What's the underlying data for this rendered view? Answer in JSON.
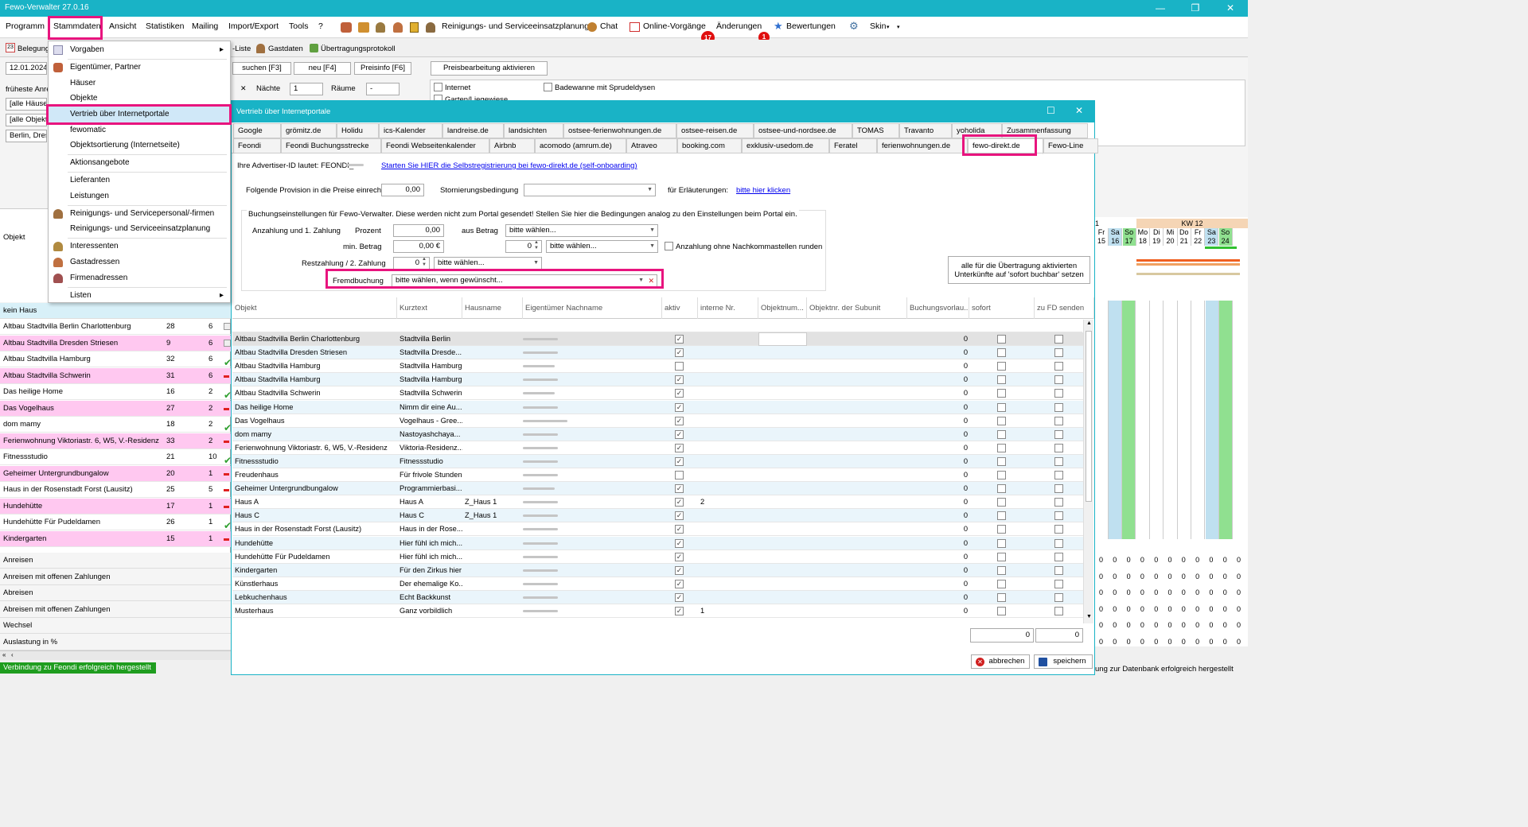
{
  "window": {
    "title": "Fewo-Verwalter 27.0.16"
  },
  "menubar": {
    "items": [
      "Programm",
      "Stammdaten",
      "Ansicht",
      "Statistiken",
      "Mailing",
      "Import/Export",
      "Tools",
      "?"
    ],
    "reinigung": "Reinigungs- und Serviceeinsatzplanung",
    "chat": "Chat",
    "online": "Online-Vorgänge",
    "online_badge": "17",
    "aenderungen": "Änderungen",
    "aenderungen_badge": "1",
    "bewertungen": "Bewertungen",
    "skin": "Skin"
  },
  "toolbar": {
    "belegung": "Belegung",
    "liste": "-Liste",
    "gastdaten": "Gastdaten",
    "protokoll": "Übertragungsprotokoll",
    "suchen": "suchen [F3]",
    "neu": "neu [F4]",
    "preisinfo": "Preisinfo [F6]",
    "preisbearbeitung": "Preisbearbeitung aktivieren",
    "naechte": "Nächte",
    "naechte_value": "1",
    "raeume": "Räume",
    "raeume_value": "-",
    "internet": "Internet",
    "badewanne": "Badewanne mit Sprudeldysen",
    "garten": "Garten/Liegewiese"
  },
  "leftpanel": {
    "date": "12.01.2024",
    "frueheste": "früheste Anre",
    "haeuser": "[alle Häuser]",
    "objekte": "[alle Objekte",
    "stadt": "Berlin, Dresde",
    "objekt_header": "Objekt"
  },
  "dropdown": {
    "items": [
      "Vorgaben",
      "Eigentümer, Partner",
      "Häuser",
      "Objekte",
      "Vertrieb über Internetportale",
      "fewomatic",
      "Objektsortierung (Internetseite)",
      "Aktionsangebote",
      "Lieferanten",
      "Leistungen",
      "Reinigungs- und Servicepersonal/-firmen",
      "Reinigungs- und Serviceeinsatzplanung",
      "Interessenten",
      "Gastadressen",
      "Firmenadressen",
      "Listen"
    ]
  },
  "houses": {
    "kein_haus": "kein Haus",
    "rows": [
      {
        "name": "Altbau Stadtvilla Berlin Charlottenburg",
        "a": "28",
        "b": "6",
        "pink": false,
        "mark": "grid"
      },
      {
        "name": "Altbau Stadtvilla Dresden Striesen",
        "a": "9",
        "b": "6",
        "pink": true,
        "mark": "grid"
      },
      {
        "name": "Altbau Stadtvilla Hamburg",
        "a": "32",
        "b": "6",
        "pink": false,
        "mark": "check"
      },
      {
        "name": "Altbau Stadtvilla Schwerin",
        "a": "31",
        "b": "6",
        "pink": true,
        "mark": "red"
      },
      {
        "name": "Das heilige Home",
        "a": "16",
        "b": "2",
        "pink": false,
        "mark": "check"
      },
      {
        "name": "Das Vogelhaus",
        "a": "27",
        "b": "2",
        "pink": true,
        "mark": "red"
      },
      {
        "name": "dom mamy",
        "a": "18",
        "b": "2",
        "pink": false,
        "mark": "check"
      },
      {
        "name": "Ferienwohnung Viktoriastr. 6, W5, V.-Residenz",
        "a": "33",
        "b": "2",
        "pink": true,
        "mark": "red"
      },
      {
        "name": "Fitnessstudio",
        "a": "21",
        "b": "10",
        "pink": false,
        "mark": "check"
      },
      {
        "name": "Geheimer Untergrundbungalow",
        "a": "20",
        "b": "1",
        "pink": true,
        "mark": "red"
      },
      {
        "name": "Haus in der Rosenstadt Forst (Lausitz)",
        "a": "25",
        "b": "5",
        "pink": false,
        "mark": "red"
      },
      {
        "name": "Hundehütte",
        "a": "17",
        "b": "1",
        "pink": true,
        "mark": "red"
      },
      {
        "name": "Hundehütte Für Pudeldamen",
        "a": "26",
        "b": "1",
        "pink": false,
        "mark": "check"
      },
      {
        "name": "Kindergarten",
        "a": "15",
        "b": "1",
        "pink": true,
        "mark": "red"
      }
    ],
    "sections": [
      "Anreisen",
      "Anreisen mit offenen Zahlungen",
      "Abreisen",
      "Abreisen mit offenen Zahlungen",
      "Wechsel",
      "Auslastung in %"
    ]
  },
  "status": {
    "left": "Verbindung zu Feondi erfolgreich hergestellt",
    "right": "ung zur Datenbank erfolgreich hergestellt"
  },
  "dialog": {
    "title": "Vertrieb über Internetportale",
    "tabs_row1": [
      "Google",
      "grömitz.de",
      "Holidu",
      "ics-Kalender",
      "landreise.de",
      "landsichten",
      "ostsee-ferienwohnungen.de",
      "ostsee-reisen.de",
      "ostsee-und-nordsee.de",
      "TOMAS",
      "Travanto",
      "yoholida",
      "Zusammenfassung"
    ],
    "tabs_row2": [
      "Feondi",
      "Feondi Buchungsstrecke",
      "Feondi Webseitenkalender",
      "Airbnb",
      "acomodo (amrum.de)",
      "Atraveo",
      "booking.com",
      "exklusiv-usedom.de",
      "Feratel",
      "ferienwohnungen.de",
      "fewo-direkt.de",
      "Fewo-Line"
    ],
    "advertiser": "Ihre Advertiser-ID lautet: FEONDI_",
    "selfonboarding": "Starten Sie HIER die Selbstregistrierung bei fewo-direkt.de (self-onboarding)",
    "provision_label": "Folgende Provision in die Preise einrechnen",
    "provision_value": "0,00",
    "storno_label": "Stornierungsbedingung",
    "erlaeuterung_label": "für Erläuterungen:",
    "erlaeuterung_link": "bitte hier klicken",
    "group_title": "Buchungseinstellungen für Fewo-Verwalter. Diese werden nicht zum Portal gesendet! Stellen Sie hier die Bedingungen analog zu den Einstellungen beim Portal ein.",
    "anzahlung_label": "Anzahlung und 1. Zahlung",
    "prozent_label": "Prozent",
    "prozent_value": "0,00",
    "aus_betrag": "aus Betrag",
    "bitte_waehlen": "bitte wählen...",
    "min_betrag_label": "min. Betrag",
    "min_betrag_value": "0,00 €",
    "min_spin": "0",
    "ohne_nachkomma": "Anzahlung ohne Nachkommastellen runden",
    "restzahlung_label": "Restzahlung / 2. Zahlung",
    "rest_spin": "0",
    "fremdbuchung_label": "Fremdbuchung",
    "fremdbuchung_value": "bitte wählen, wenn gewünscht...",
    "sofort_button": "alle für die Übertragung aktivierten Unterkünfte auf 'sofort buchbar' setzen",
    "columns": [
      "Objekt",
      "Kurztext",
      "Hausname",
      "Eigentümer Nachname",
      "aktiv",
      "interne Nr.",
      "Objektnum...",
      "Objektnr. der Subunit",
      "Buchungsvorlau...",
      "sofort",
      "zu FD senden"
    ],
    "rows": [
      {
        "objekt": "Altbau Stadtvilla Berlin Charlottenburg",
        "kurz": "Stadtvilla Berlin",
        "haus": "",
        "aktiv": true,
        "nr": "",
        "bv": "0"
      },
      {
        "objekt": "Altbau Stadtvilla Dresden Striesen",
        "kurz": "Stadtvilla Dresde...",
        "haus": "",
        "aktiv": true,
        "nr": "",
        "bv": "0"
      },
      {
        "objekt": "Altbau Stadtvilla Hamburg",
        "kurz": "Stadtvilla Hamburg",
        "haus": "",
        "aktiv": false,
        "nr": "",
        "bv": "0"
      },
      {
        "objekt": "Altbau Stadtvilla Hamburg",
        "kurz": "Stadtvilla Hamburg",
        "haus": "",
        "aktiv": true,
        "nr": "",
        "bv": "0"
      },
      {
        "objekt": "Altbau Stadtvilla Schwerin",
        "kurz": "Stadtvilla Schwerin",
        "haus": "",
        "aktiv": true,
        "nr": "",
        "bv": "0"
      },
      {
        "objekt": "Das heilige Home",
        "kurz": "Nimm dir eine Au...",
        "haus": "",
        "aktiv": true,
        "nr": "",
        "bv": "0"
      },
      {
        "objekt": "Das Vogelhaus",
        "kurz": "Vogelhaus - Gree...",
        "haus": "",
        "aktiv": true,
        "nr": "",
        "bv": "0"
      },
      {
        "objekt": "dom mamy",
        "kurz": "Nastoyashchaya...",
        "haus": "",
        "aktiv": true,
        "nr": "",
        "bv": "0"
      },
      {
        "objekt": "Ferienwohnung Viktoriastr. 6, W5, V.-Residenz",
        "kurz": "Viktoria-Residenz...",
        "haus": "",
        "aktiv": true,
        "nr": "",
        "bv": "0"
      },
      {
        "objekt": "Fitnessstudio",
        "kurz": "Fitnessstudio",
        "haus": "",
        "aktiv": true,
        "nr": "",
        "bv": "0"
      },
      {
        "objekt": "Freudenhaus",
        "kurz": "Für frivole Stunden",
        "haus": "",
        "aktiv": false,
        "nr": "",
        "bv": "0"
      },
      {
        "objekt": "Geheimer Untergrundbungalow",
        "kurz": "Programmierbasi...",
        "haus": "",
        "aktiv": true,
        "nr": "",
        "bv": "0"
      },
      {
        "objekt": "Haus A",
        "kurz": "Haus A",
        "haus": "Z_Haus 1",
        "aktiv": true,
        "nr": "2",
        "bv": "0"
      },
      {
        "objekt": "Haus C",
        "kurz": "Haus C",
        "haus": "Z_Haus 1",
        "aktiv": true,
        "nr": "",
        "bv": "0"
      },
      {
        "objekt": "Haus in der Rosenstadt Forst (Lausitz)",
        "kurz": "Haus in der Rose...",
        "haus": "",
        "aktiv": true,
        "nr": "",
        "bv": "0"
      },
      {
        "objekt": "Hundehütte",
        "kurz": "Hier fühl ich mich...",
        "haus": "",
        "aktiv": true,
        "nr": "",
        "bv": "0"
      },
      {
        "objekt": "Hundehütte Für Pudeldamen",
        "kurz": "Hier fühl ich mich...",
        "haus": "",
        "aktiv": true,
        "nr": "",
        "bv": "0"
      },
      {
        "objekt": "Kindergarten",
        "kurz": "Für den Zirkus hier",
        "haus": "",
        "aktiv": true,
        "nr": "",
        "bv": "0"
      },
      {
        "objekt": "Künstlerhaus",
        "kurz": "Der ehemalige Ko...",
        "haus": "",
        "aktiv": true,
        "nr": "",
        "bv": "0"
      },
      {
        "objekt": "Lebkuchenhaus",
        "kurz": "Echt Backkunst",
        "haus": "",
        "aktiv": true,
        "nr": "",
        "bv": "0"
      },
      {
        "objekt": "Musterhaus",
        "kurz": "Ganz vorbildlich",
        "haus": "",
        "aktiv": true,
        "nr": "1",
        "bv": "0"
      }
    ],
    "sum1": "0",
    "sum2": "0",
    "abbrechen": "abbrechen",
    "speichern": "speichern"
  },
  "calendar": {
    "kw": "KW 12",
    "days": [
      "Fr",
      "Sa",
      "So",
      "Mo",
      "Di",
      "Mi",
      "Do",
      "Fr",
      "Sa",
      "So"
    ],
    "dates": [
      "15",
      "16",
      "17",
      "18",
      "19",
      "20",
      "21",
      "22",
      "23",
      "24"
    ],
    "zero": "0"
  }
}
